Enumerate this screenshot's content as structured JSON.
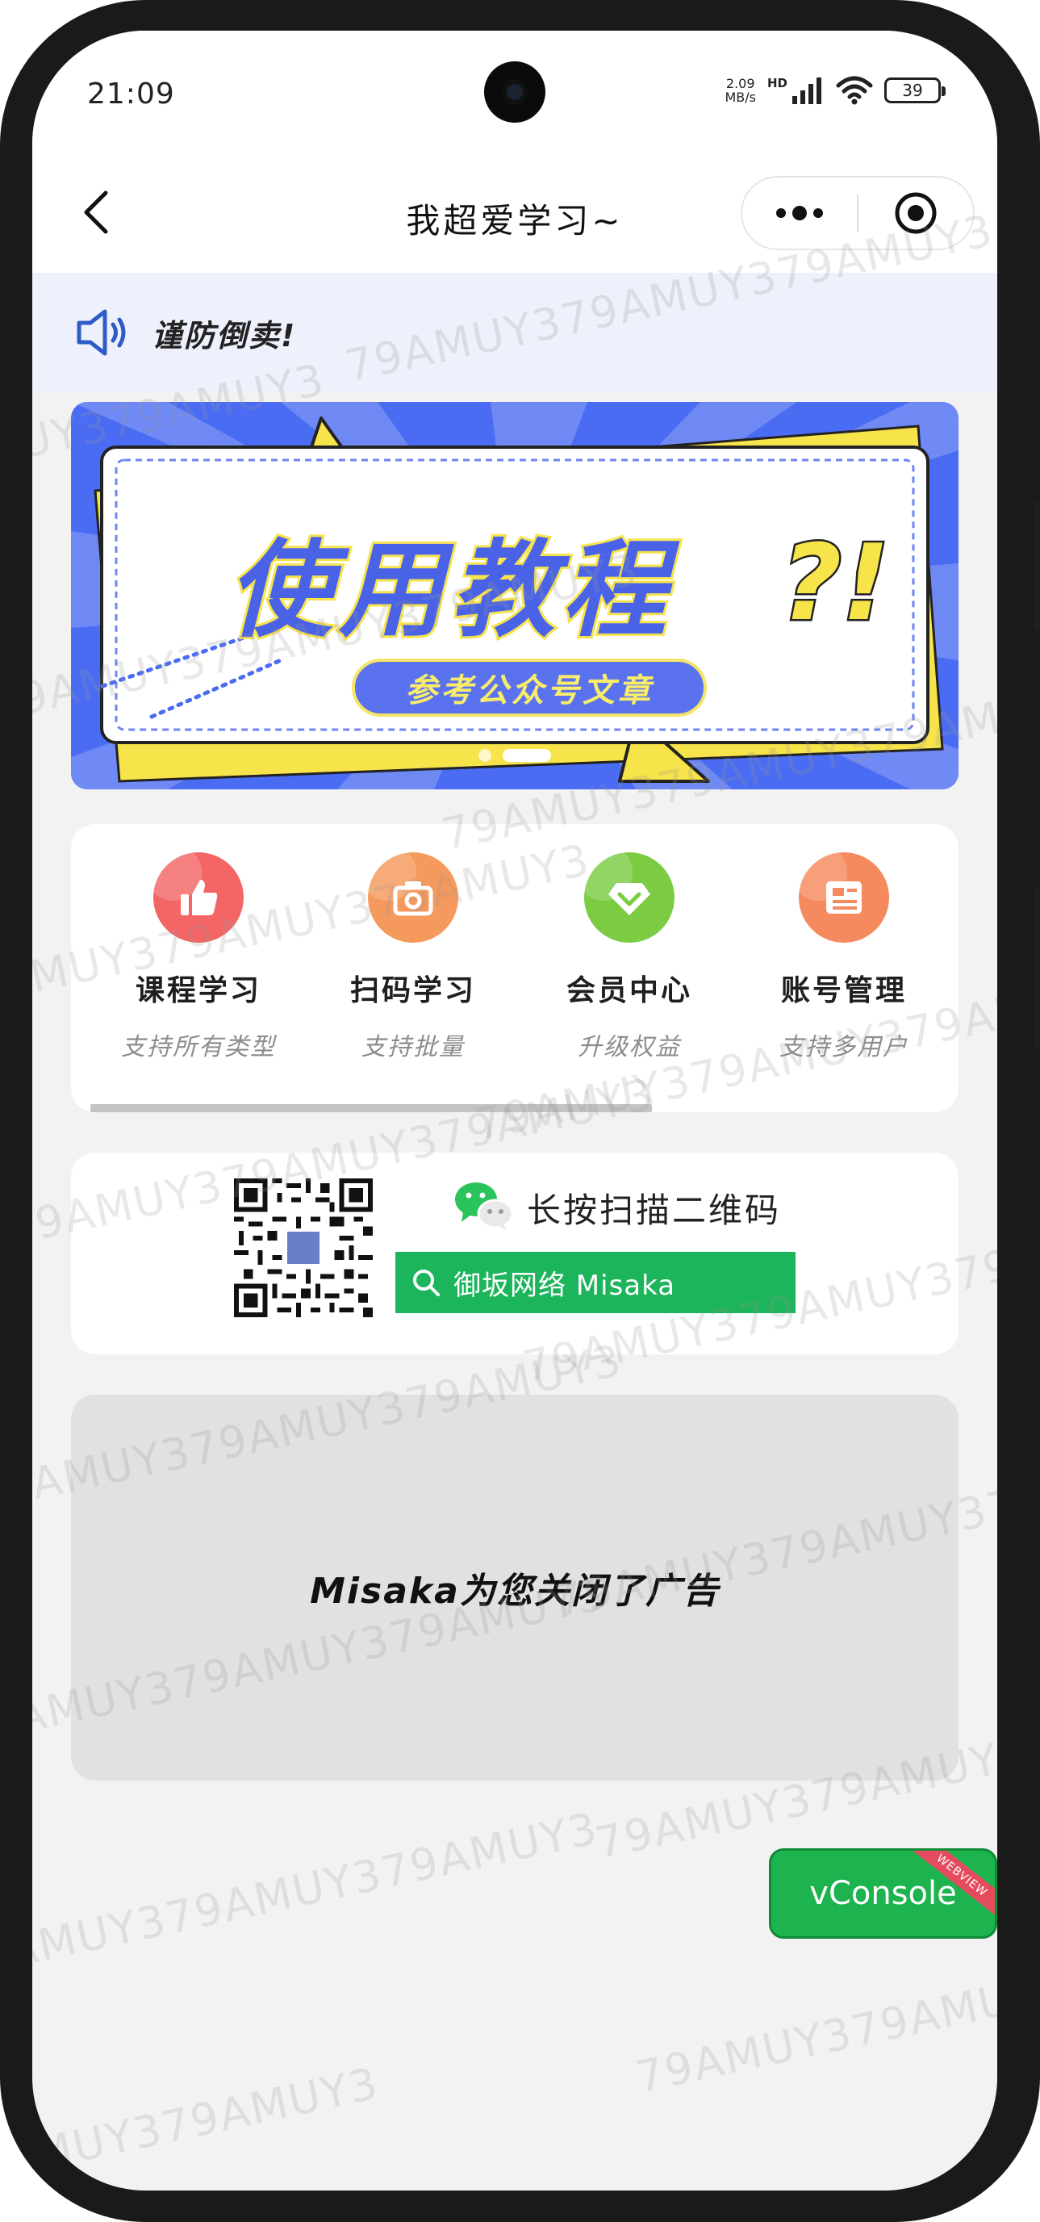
{
  "status_bar": {
    "time": "21:09",
    "net_speed_value": "2.09",
    "net_speed_unit": "MB/s",
    "hd_label": "HD",
    "battery": "39"
  },
  "nav": {
    "title": "我超爱学习~"
  },
  "notice": {
    "text": "谨防倒卖!"
  },
  "banner": {
    "title": "使用教程",
    "title_mark": "?!",
    "subtitle": "参考公众号文章",
    "colors": {
      "background": "#4a6cf2",
      "accent": "#f7e34a"
    }
  },
  "menu": {
    "items": [
      {
        "label": "课程学习",
        "sub": "支持所有类型",
        "icon": "thumbs-up-icon",
        "color": "#f46666"
      },
      {
        "label": "扫码学习",
        "sub": "支持批量",
        "icon": "camera-icon",
        "color": "#f6995c"
      },
      {
        "label": "会员中心",
        "sub": "升级权益",
        "icon": "diamond-icon",
        "color": "#7ccc43"
      },
      {
        "label": "账号管理",
        "sub": "支持多用户",
        "icon": "id-card-icon",
        "color": "#f68a5f"
      }
    ]
  },
  "qr": {
    "title": "长按扫描二维码",
    "search_text": "御坂网络 Misaka",
    "search_color": "#1db55c"
  },
  "ad": {
    "text": "Misaka为您关闭了广告"
  },
  "vconsole": {
    "label": "vConsole",
    "ribbon": "WEBVIEW"
  },
  "watermark": {
    "text_a": "79AMUY379AMUY379AMUY3",
    "text_b": "UY379AMUY3",
    "text_c": "AMUY379AMUY3"
  }
}
